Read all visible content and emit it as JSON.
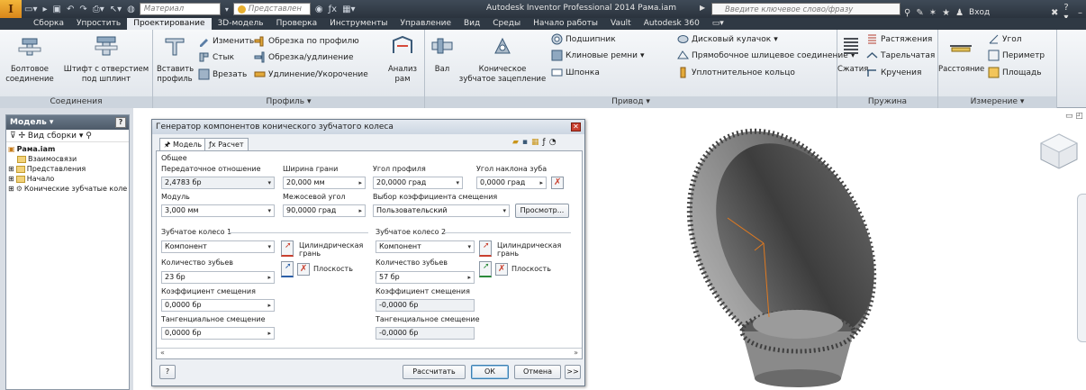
{
  "titlebar": {
    "logo": "I",
    "logo_sub": "PRO",
    "material_combo": "Материал",
    "appearance_combo": "Представлен",
    "app_title": "Autodesk Inventor Professional 2014   Рама.iam",
    "search_placeholder": "Введите ключевое слово/фразу",
    "sign_in": "Вход",
    "colors": {
      "bar": "#2b333d",
      "accent": "#e89a2a"
    }
  },
  "tabs": [
    "Сборка",
    "Упростить",
    "Проектирование",
    "3D-модель",
    "Проверка",
    "Инструменты",
    "Управление",
    "Вид",
    "Среды",
    "Начало работы",
    "Vault",
    "Autodesk 360"
  ],
  "active_tab": "Проектирование",
  "ribbon": {
    "connections": {
      "title": "Соединения",
      "bolt_line1": "Болтовое",
      "bolt_line2": "соединение",
      "pin_line1": "Штифт с отверстием",
      "pin_line2": "под шплинт"
    },
    "profile": {
      "title": "Профиль ▾",
      "insert_line1": "Вставить",
      "insert_line2": "профиль",
      "change": "Изменить",
      "joint": "Стык",
      "cut": "Врезать",
      "trim_profile": "Обрезка по профилю",
      "trim_extend": "Обрезка/удлинение",
      "lengthen": "Удлинение/Укорочение",
      "analysis_line1": "Анализ",
      "analysis_line2": "рам"
    },
    "drive": {
      "title": "Привод ▾",
      "shaft": "Вал",
      "bevel_line1": "Коническое",
      "bevel_line2": "зубчатое зацепление",
      "bearing": "Подшипник",
      "vbelts": "Клиновые ремни",
      "key": "Шпонка",
      "disc_cam": "Дисковый кулачок",
      "spline": "Прямобочное шлицевое соединение",
      "oring": "Уплотнительное кольцо"
    },
    "spring": {
      "title": "Пружина",
      "compression": "Сжатия",
      "tension": "Растяжения",
      "belleville": "Тарельчатая",
      "torsion": "Кручения"
    },
    "measure": {
      "title": "Измерение ▾",
      "distance": "Расстояние",
      "angle": "Угол",
      "perimeter": "Периметр",
      "area": "Площадь"
    }
  },
  "browser": {
    "title": "Модель ▾",
    "view_label": "Вид сборки",
    "items": [
      "Рама.iam",
      "Взаимосвязи",
      "Представления",
      "Начало",
      "Конические зубчатые коле"
    ]
  },
  "dialog": {
    "title": "Генератор компонентов конического зубчатого колеса",
    "tab_model": "Модель",
    "tab_calc": "Расчет",
    "general": "Общее",
    "gear_ratio_label": "Передаточное отношение",
    "gear_ratio": "2,4783 бр",
    "face_width_label": "Ширина грани",
    "face_width": "20,000 мм",
    "pressure_angle_label": "Угол профиля",
    "pressure_angle": "20,0000 град",
    "helix_angle_label": "Угол наклона зуба",
    "helix_angle": "0,0000 град",
    "module_label": "Модуль",
    "module": "3,000 мм",
    "shaft_angle_label": "Межосевой угол",
    "shaft_angle": "90,0000 град",
    "shift_choice_label": "Выбор коэффициента смещения",
    "shift_choice": "Пользовательский",
    "preview_button": "Просмотр...",
    "gear1": {
      "title": "Зубчатое колесо 1",
      "type": "Компонент",
      "cyl_face_line1": "Цилиндрическая",
      "cyl_face_line2": "грань",
      "plane": "Плоскость",
      "teeth_label": "Количество зубьев",
      "teeth": "23 бр",
      "shift_label": "Коэффициент смещения",
      "shift": "0,0000 бр",
      "tangent_label": "Тангенциальное смещение",
      "tangent": "0,0000 бр"
    },
    "gear2": {
      "title": "Зубчатое колесо 2",
      "type": "Компонент",
      "cyl_face_line1": "Цилиндрическая",
      "cyl_face_line2": "грань",
      "plane": "Плоскость",
      "teeth_label": "Количество зубьев",
      "teeth": "57 бр",
      "shift_label": "Коэффициент смещения",
      "shift": "-0,0000 бр",
      "tangent_label": "Тангенциальное смещение",
      "tangent": "-0,0000 бр"
    },
    "calculate": "Рассчитать",
    "ok": "ОК",
    "cancel": "Отмена",
    "more": ">>",
    "help": "?"
  }
}
